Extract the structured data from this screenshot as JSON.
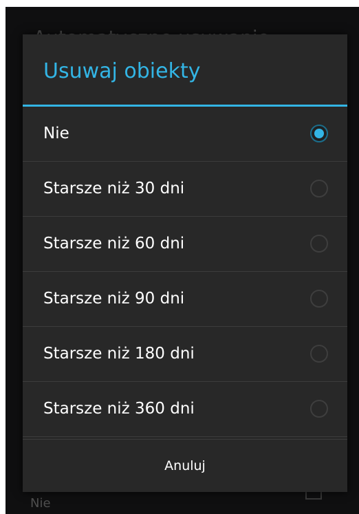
{
  "background": {
    "title": "Automatyczne usuwanie",
    "value": "Nie"
  },
  "dialog": {
    "title": "Usuwaj obiekty",
    "options": [
      {
        "label": "Nie",
        "selected": true
      },
      {
        "label": "Starsze niż 30 dni",
        "selected": false
      },
      {
        "label": "Starsze niż 60 dni",
        "selected": false
      },
      {
        "label": "Starsze niż 90 dni",
        "selected": false
      },
      {
        "label": "Starsze niż 180 dni",
        "selected": false
      },
      {
        "label": "Starsze niż 360 dni",
        "selected": false
      }
    ],
    "cancel_label": "Anuluj"
  },
  "colors": {
    "accent": "#33b5e5",
    "dialog_bg": "#282828",
    "screen_bg": "#0f0f10"
  }
}
